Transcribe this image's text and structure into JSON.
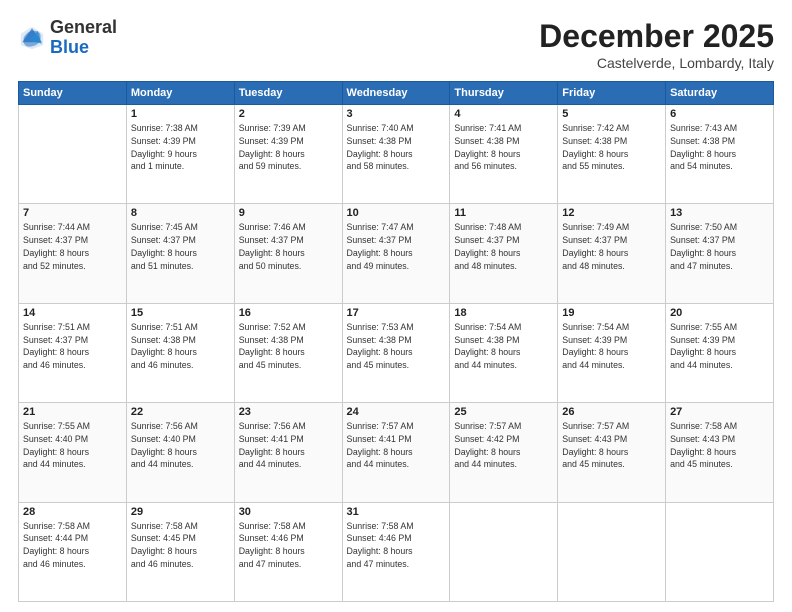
{
  "header": {
    "logo_general": "General",
    "logo_blue": "Blue",
    "month_title": "December 2025",
    "location": "Castelverde, Lombardy, Italy"
  },
  "weekdays": [
    "Sunday",
    "Monday",
    "Tuesday",
    "Wednesday",
    "Thursday",
    "Friday",
    "Saturday"
  ],
  "weeks": [
    [
      {
        "day": "",
        "info": ""
      },
      {
        "day": "1",
        "info": "Sunrise: 7:38 AM\nSunset: 4:39 PM\nDaylight: 9 hours\nand 1 minute."
      },
      {
        "day": "2",
        "info": "Sunrise: 7:39 AM\nSunset: 4:39 PM\nDaylight: 8 hours\nand 59 minutes."
      },
      {
        "day": "3",
        "info": "Sunrise: 7:40 AM\nSunset: 4:38 PM\nDaylight: 8 hours\nand 58 minutes."
      },
      {
        "day": "4",
        "info": "Sunrise: 7:41 AM\nSunset: 4:38 PM\nDaylight: 8 hours\nand 56 minutes."
      },
      {
        "day": "5",
        "info": "Sunrise: 7:42 AM\nSunset: 4:38 PM\nDaylight: 8 hours\nand 55 minutes."
      },
      {
        "day": "6",
        "info": "Sunrise: 7:43 AM\nSunset: 4:38 PM\nDaylight: 8 hours\nand 54 minutes."
      }
    ],
    [
      {
        "day": "7",
        "info": "Sunrise: 7:44 AM\nSunset: 4:37 PM\nDaylight: 8 hours\nand 52 minutes."
      },
      {
        "day": "8",
        "info": "Sunrise: 7:45 AM\nSunset: 4:37 PM\nDaylight: 8 hours\nand 51 minutes."
      },
      {
        "day": "9",
        "info": "Sunrise: 7:46 AM\nSunset: 4:37 PM\nDaylight: 8 hours\nand 50 minutes."
      },
      {
        "day": "10",
        "info": "Sunrise: 7:47 AM\nSunset: 4:37 PM\nDaylight: 8 hours\nand 49 minutes."
      },
      {
        "day": "11",
        "info": "Sunrise: 7:48 AM\nSunset: 4:37 PM\nDaylight: 8 hours\nand 48 minutes."
      },
      {
        "day": "12",
        "info": "Sunrise: 7:49 AM\nSunset: 4:37 PM\nDaylight: 8 hours\nand 48 minutes."
      },
      {
        "day": "13",
        "info": "Sunrise: 7:50 AM\nSunset: 4:37 PM\nDaylight: 8 hours\nand 47 minutes."
      }
    ],
    [
      {
        "day": "14",
        "info": "Sunrise: 7:51 AM\nSunset: 4:37 PM\nDaylight: 8 hours\nand 46 minutes."
      },
      {
        "day": "15",
        "info": "Sunrise: 7:51 AM\nSunset: 4:38 PM\nDaylight: 8 hours\nand 46 minutes."
      },
      {
        "day": "16",
        "info": "Sunrise: 7:52 AM\nSunset: 4:38 PM\nDaylight: 8 hours\nand 45 minutes."
      },
      {
        "day": "17",
        "info": "Sunrise: 7:53 AM\nSunset: 4:38 PM\nDaylight: 8 hours\nand 45 minutes."
      },
      {
        "day": "18",
        "info": "Sunrise: 7:54 AM\nSunset: 4:38 PM\nDaylight: 8 hours\nand 44 minutes."
      },
      {
        "day": "19",
        "info": "Sunrise: 7:54 AM\nSunset: 4:39 PM\nDaylight: 8 hours\nand 44 minutes."
      },
      {
        "day": "20",
        "info": "Sunrise: 7:55 AM\nSunset: 4:39 PM\nDaylight: 8 hours\nand 44 minutes."
      }
    ],
    [
      {
        "day": "21",
        "info": "Sunrise: 7:55 AM\nSunset: 4:40 PM\nDaylight: 8 hours\nand 44 minutes."
      },
      {
        "day": "22",
        "info": "Sunrise: 7:56 AM\nSunset: 4:40 PM\nDaylight: 8 hours\nand 44 minutes."
      },
      {
        "day": "23",
        "info": "Sunrise: 7:56 AM\nSunset: 4:41 PM\nDaylight: 8 hours\nand 44 minutes."
      },
      {
        "day": "24",
        "info": "Sunrise: 7:57 AM\nSunset: 4:41 PM\nDaylight: 8 hours\nand 44 minutes."
      },
      {
        "day": "25",
        "info": "Sunrise: 7:57 AM\nSunset: 4:42 PM\nDaylight: 8 hours\nand 44 minutes."
      },
      {
        "day": "26",
        "info": "Sunrise: 7:57 AM\nSunset: 4:43 PM\nDaylight: 8 hours\nand 45 minutes."
      },
      {
        "day": "27",
        "info": "Sunrise: 7:58 AM\nSunset: 4:43 PM\nDaylight: 8 hours\nand 45 minutes."
      }
    ],
    [
      {
        "day": "28",
        "info": "Sunrise: 7:58 AM\nSunset: 4:44 PM\nDaylight: 8 hours\nand 46 minutes."
      },
      {
        "day": "29",
        "info": "Sunrise: 7:58 AM\nSunset: 4:45 PM\nDaylight: 8 hours\nand 46 minutes."
      },
      {
        "day": "30",
        "info": "Sunrise: 7:58 AM\nSunset: 4:46 PM\nDaylight: 8 hours\nand 47 minutes."
      },
      {
        "day": "31",
        "info": "Sunrise: 7:58 AM\nSunset: 4:46 PM\nDaylight: 8 hours\nand 47 minutes."
      },
      {
        "day": "",
        "info": ""
      },
      {
        "day": "",
        "info": ""
      },
      {
        "day": "",
        "info": ""
      }
    ]
  ]
}
